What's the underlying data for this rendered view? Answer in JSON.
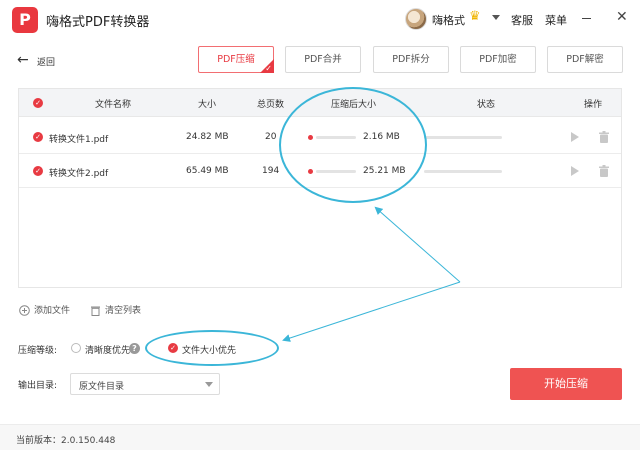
{
  "app": {
    "logo_letter": "P",
    "title": "嗨格式PDF转换器"
  },
  "user": {
    "name": "嗨格式",
    "crown_glyph": "♛"
  },
  "titlebar": {
    "service_label": "客服",
    "menu_label": "菜单",
    "close_glyph": "✕"
  },
  "nav": {
    "back_glyph": "←",
    "back_label": "返回"
  },
  "tabs": [
    {
      "label": "PDF压缩",
      "active": true
    },
    {
      "label": "PDF合并",
      "active": false
    },
    {
      "label": "PDF拆分",
      "active": false
    },
    {
      "label": "PDF加密",
      "active": false
    },
    {
      "label": "PDF解密",
      "active": false
    }
  ],
  "table": {
    "headers": {
      "name": "文件名称",
      "size": "大小",
      "pages": "总页数",
      "compressed": "压缩后大小",
      "status": "状态",
      "actions": "操作"
    },
    "rows": [
      {
        "name": "转换文件1.pdf",
        "size": "24.82 MB",
        "pages": "20",
        "compressed": "2.16 MB"
      },
      {
        "name": "转换文件2.pdf",
        "size": "65.49 MB",
        "pages": "194",
        "compressed": "25.21 MB"
      }
    ]
  },
  "footer_actions": {
    "add_file": "添加文件",
    "clear_list": "清空列表"
  },
  "compression": {
    "level_label": "压缩等级:",
    "options": [
      {
        "label": "清晰度优先",
        "selected": false
      },
      {
        "label": "文件大小优先",
        "selected": true
      }
    ],
    "help_glyph": "?"
  },
  "output": {
    "label": "输出目录:",
    "value": "原文件目录"
  },
  "start_button": "开始压缩",
  "version_text": "当前版本：2.0.150.448",
  "colors": {
    "accent": "#e83a42",
    "annotation": "#3bb6d8"
  }
}
